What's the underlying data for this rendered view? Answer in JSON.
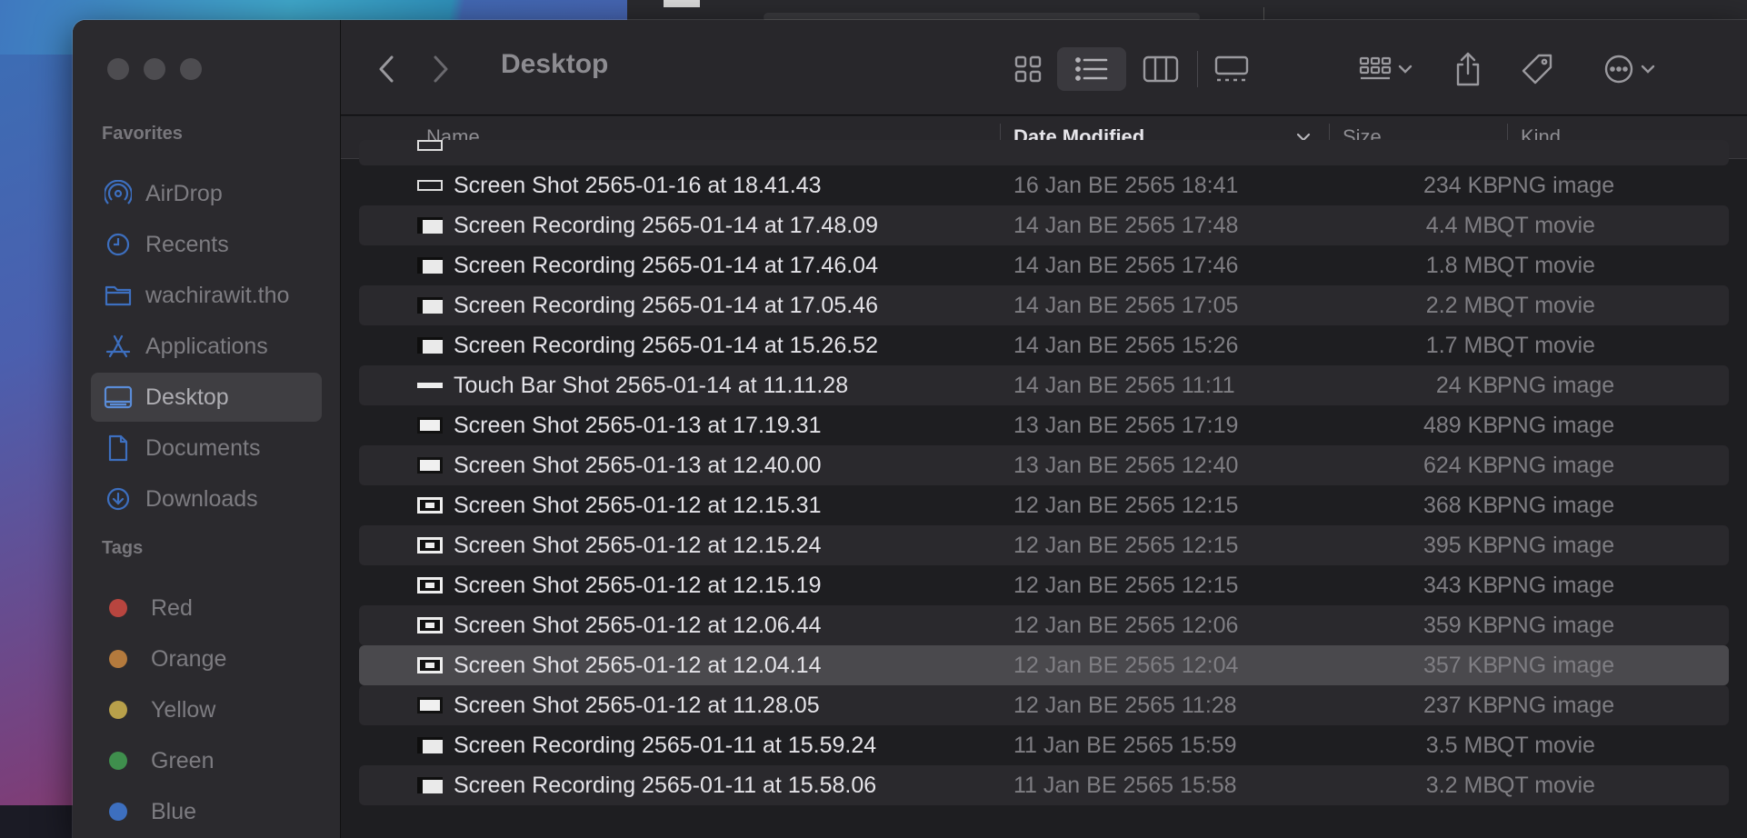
{
  "window_title": "Desktop",
  "sidebar": {
    "favorites_heading": "Favorites",
    "favorites": [
      {
        "label": "AirDrop",
        "icon": "airdrop-icon"
      },
      {
        "label": "Recents",
        "icon": "clock-icon"
      },
      {
        "label": "wachirawit.tho",
        "icon": "folder-icon"
      },
      {
        "label": "Applications",
        "icon": "applications-icon"
      },
      {
        "label": "Desktop",
        "icon": "desktop-icon",
        "active": true
      },
      {
        "label": "Documents",
        "icon": "document-icon"
      },
      {
        "label": "Downloads",
        "icon": "download-icon"
      }
    ],
    "tags_heading": "Tags",
    "tags": [
      {
        "label": "Red",
        "color": "#b8453f"
      },
      {
        "label": "Orange",
        "color": "#b47a3d"
      },
      {
        "label": "Yellow",
        "color": "#b8a04a"
      },
      {
        "label": "Green",
        "color": "#3f8f4d"
      },
      {
        "label": "Blue",
        "color": "#3d6fbf"
      }
    ]
  },
  "columns": {
    "name": "Name",
    "date": "Date Modified",
    "size": "Size",
    "kind": "Kind"
  },
  "rows": [
    {
      "name": "Screen Shot 2565-01-16 at 18.41.43",
      "date": "16 Jan BE 2565 18:41",
      "size": "234 KB",
      "kind": "PNG image",
      "thumb": "outline"
    },
    {
      "name": "Screen Recording 2565-01-14 at 17.48.09",
      "date": "14 Jan BE 2565 17:48",
      "size": "4.4 MB",
      "kind": "QT movie",
      "thumb": "movie"
    },
    {
      "name": "Screen Recording 2565-01-14 at 17.46.04",
      "date": "14 Jan BE 2565 17:46",
      "size": "1.8 MB",
      "kind": "QT movie",
      "thumb": "movie"
    },
    {
      "name": "Screen Recording 2565-01-14 at 17.05.46",
      "date": "14 Jan BE 2565 17:05",
      "size": "2.2 MB",
      "kind": "QT movie",
      "thumb": "movie"
    },
    {
      "name": "Screen Recording 2565-01-14 at 15.26.52",
      "date": "14 Jan BE 2565 15:26",
      "size": "1.7 MB",
      "kind": "QT movie",
      "thumb": "movie"
    },
    {
      "name": "Touch Bar Shot 2565-01-14 at 11.11.28",
      "date": "14 Jan BE 2565 11:11",
      "size": "24 KB",
      "kind": "PNG image",
      "thumb": "thin"
    },
    {
      "name": "Screen Shot 2565-01-13 at 17.19.31",
      "date": "13 Jan BE 2565 17:19",
      "size": "489 KB",
      "kind": "PNG image",
      "thumb": "shot"
    },
    {
      "name": "Screen Shot 2565-01-13 at 12.40.00",
      "date": "13 Jan BE 2565 12:40",
      "size": "624 KB",
      "kind": "PNG image",
      "thumb": "shot"
    },
    {
      "name": "Screen Shot 2565-01-12 at 12.15.31",
      "date": "12 Jan BE 2565 12:15",
      "size": "368 KB",
      "kind": "PNG image",
      "thumb": "shot-dark"
    },
    {
      "name": "Screen Shot 2565-01-12 at 12.15.24",
      "date": "12 Jan BE 2565 12:15",
      "size": "395 KB",
      "kind": "PNG image",
      "thumb": "shot-dark"
    },
    {
      "name": "Screen Shot 2565-01-12 at 12.15.19",
      "date": "12 Jan BE 2565 12:15",
      "size": "343 KB",
      "kind": "PNG image",
      "thumb": "shot-dark"
    },
    {
      "name": "Screen Shot 2565-01-12 at 12.06.44",
      "date": "12 Jan BE 2565 12:06",
      "size": "359 KB",
      "kind": "PNG image",
      "thumb": "shot-dark"
    },
    {
      "name": "Screen Shot 2565-01-12 at 12.04.14",
      "date": "12 Jan BE 2565 12:04",
      "size": "357 KB",
      "kind": "PNG image",
      "thumb": "shot-dark",
      "selected": true
    },
    {
      "name": "Screen Shot 2565-01-12 at 11.28.05",
      "date": "12 Jan BE 2565 11:28",
      "size": "237 KB",
      "kind": "PNG image",
      "thumb": "shot"
    },
    {
      "name": "Screen Recording 2565-01-11 at 15.59.24",
      "date": "11 Jan BE 2565 15:59",
      "size": "3.5 MB",
      "kind": "QT movie",
      "thumb": "movie"
    },
    {
      "name": "Screen Recording 2565-01-11 at 15.58.06",
      "date": "11 Jan BE 2565 15:58",
      "size": "3.2 MB",
      "kind": "QT movie",
      "thumb": "movie"
    }
  ]
}
